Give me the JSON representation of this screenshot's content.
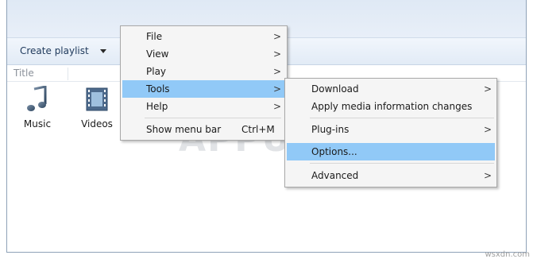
{
  "toolbar": {
    "create_playlist_label": "Create playlist"
  },
  "columns": {
    "title_label": "Title"
  },
  "library": {
    "items": [
      {
        "label": "Music",
        "icon": "music-note-icon"
      },
      {
        "label": "Videos",
        "icon": "film-strip-icon"
      }
    ]
  },
  "main_menu": {
    "items": [
      {
        "label": "File",
        "has_submenu": true
      },
      {
        "label": "View",
        "has_submenu": true
      },
      {
        "label": "Play",
        "has_submenu": true
      },
      {
        "label": "Tools",
        "has_submenu": true,
        "highlighted": true
      },
      {
        "label": "Help",
        "has_submenu": true
      },
      {
        "label": "Show menu bar",
        "shortcut": "Ctrl+M"
      }
    ],
    "submenu_arrow": ">"
  },
  "tools_menu": {
    "items": [
      {
        "label": "Download",
        "has_submenu": true
      },
      {
        "label": "Apply media information changes"
      },
      {
        "label": "Plug-ins",
        "has_submenu": true
      },
      {
        "label": "Options...",
        "highlighted": true
      },
      {
        "label": "Advanced",
        "has_submenu": true
      }
    ]
  },
  "colors": {
    "highlight": "#91c9f7",
    "menu_background": "#f5f5f5",
    "toolbar_text": "#1e395b"
  },
  "watermark": {
    "text": "APPUALS"
  },
  "credit": {
    "text": "wsxdn.com"
  }
}
